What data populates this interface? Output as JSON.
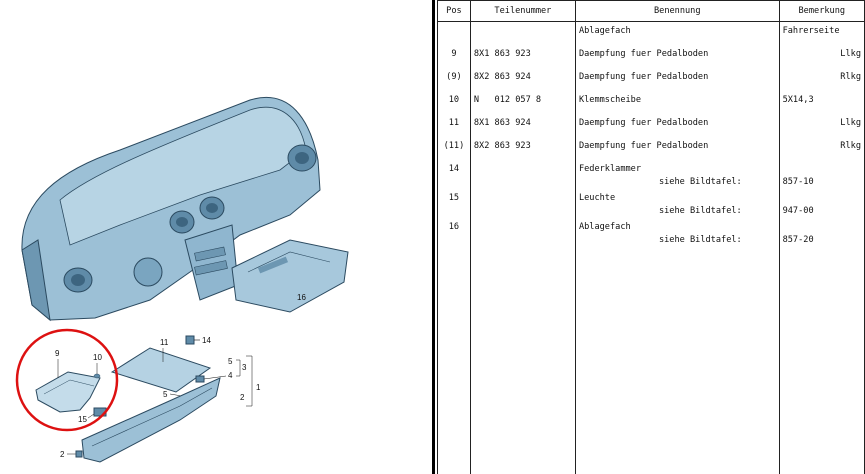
{
  "illustration": {
    "callouts": {
      "c1": "1",
      "c2": "2",
      "c3": "3",
      "c4": "4",
      "c5a": "5",
      "c5b": "5",
      "c9": "9",
      "c10": "10",
      "c11": "11",
      "c14": "14",
      "c15": "15",
      "c16": "16",
      "c2b": "2"
    },
    "colors": {
      "body": "#8fb6cf",
      "shade": "#5f8ba8",
      "line": "#2b4a60",
      "highlight": "#dd1111"
    }
  },
  "table": {
    "headers": {
      "pos": "Pos",
      "part": "Teilenummer",
      "name": "Benennung",
      "remark": "Bemerkung"
    },
    "rows": [
      {
        "pos": "",
        "part": "",
        "name": "Ablagefach",
        "remark": "Fahrerseite"
      },
      {
        "pos": "9",
        "part": "8X1 863 923",
        "name": "Daempfung fuer Pedalboden",
        "remark": "Llkg"
      },
      {
        "pos": "(9)",
        "part": "8X2 863 924",
        "name": "Daempfung fuer Pedalboden",
        "remark": "Rlkg"
      },
      {
        "pos": "10",
        "part": "N   012 057 8",
        "name": "Klemmscheibe",
        "remark": "5X14,3"
      },
      {
        "pos": "11",
        "part": "8X1 863 924",
        "name": "Daempfung fuer Pedalboden",
        "remark": "Llkg"
      },
      {
        "pos": "(11)",
        "part": "8X2 863 923",
        "name": "Daempfung fuer Pedalboden",
        "remark": "Rlkg"
      },
      {
        "pos": "14",
        "part": "",
        "name": "Federklammer",
        "see": "siehe Bildtafel:",
        "remark": "857-10"
      },
      {
        "pos": "15",
        "part": "",
        "name": "Leuchte",
        "see": "siehe Bildtafel:",
        "remark": "947-00"
      },
      {
        "pos": "16",
        "part": "",
        "name": "Ablagefach",
        "see": "siehe Bildtafel:",
        "remark": "857-20"
      }
    ]
  }
}
